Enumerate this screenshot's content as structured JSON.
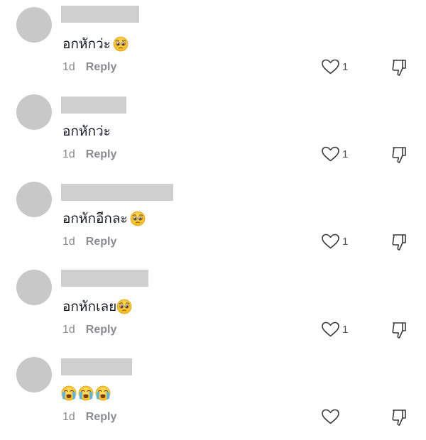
{
  "comments": [
    {
      "text": "อกหักว่ะ",
      "emojis": [
        "pleading-face-icon"
      ],
      "time": "1d",
      "reply_label": "Reply",
      "like_count": "1"
    },
    {
      "text": "อกหักว่ะ",
      "emojis": [],
      "time": "1d",
      "reply_label": "Reply",
      "like_count": "1"
    },
    {
      "text": "อกหักอีกละ",
      "emojis": [
        "pleading-face-icon"
      ],
      "time": "1d",
      "reply_label": "Reply",
      "like_count": "1"
    },
    {
      "text": "อกหักเลย",
      "emojis": [
        "pleading-face-icon"
      ],
      "time": "1d",
      "reply_label": "Reply",
      "like_count": "1"
    },
    {
      "text": "",
      "emojis": [
        "loudly-crying-face-icon",
        "loudly-crying-face-icon",
        "loudly-crying-face-icon"
      ],
      "time": "1d",
      "reply_label": "Reply",
      "like_count": ""
    }
  ],
  "colors": {
    "avatar_placeholder": "#c8c8c8",
    "redacted_name": "#cfcfcf",
    "meta_text": "#8a8b91",
    "emoji_face": "#ffcc33"
  }
}
